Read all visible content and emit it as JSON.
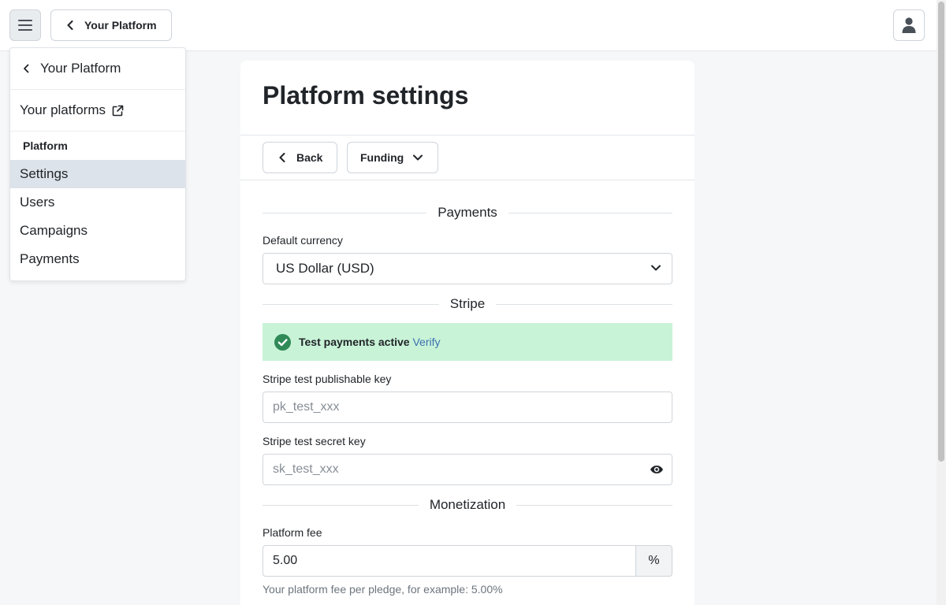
{
  "topbar": {
    "platform_button_label": "Your Platform"
  },
  "side_menu": {
    "back_label": "Your Platform",
    "external_label": "Your platforms",
    "section_heading": "Platform",
    "items": [
      {
        "label": "Settings",
        "active": true
      },
      {
        "label": "Users",
        "active": false
      },
      {
        "label": "Campaigns",
        "active": false
      },
      {
        "label": "Payments",
        "active": false
      }
    ]
  },
  "page": {
    "title": "Platform settings",
    "back_button": "Back",
    "funding_button": "Funding"
  },
  "payments": {
    "section_title": "Payments",
    "currency_label": "Default currency",
    "currency_value": "US Dollar (USD)"
  },
  "stripe": {
    "section_title": "Stripe",
    "alert_strong": "Test payments active",
    "alert_link": "Verify",
    "publishable_label": "Stripe test publishable key",
    "publishable_placeholder": "pk_test_xxx",
    "secret_label": "Stripe test secret key",
    "secret_placeholder": "sk_test_xxx"
  },
  "monetization": {
    "section_title": "Monetization",
    "fee_label": "Platform fee",
    "fee_value": "5.00",
    "fee_suffix": "%",
    "fee_help": "Your platform fee per pledge, for example: 5.00%"
  },
  "colors": {
    "alert_bg": "#c9f3d7",
    "alert_icon": "#2f8a57",
    "link": "#3b6fb0",
    "active_menu_bg": "#dde3ea"
  },
  "icons": {
    "menu": "hamburger-icon",
    "back": "chevron-left-icon",
    "user": "user-icon",
    "external": "external-link-icon",
    "dropdown": "chevron-down-icon",
    "success": "check-circle-icon",
    "reveal": "eye-icon"
  }
}
